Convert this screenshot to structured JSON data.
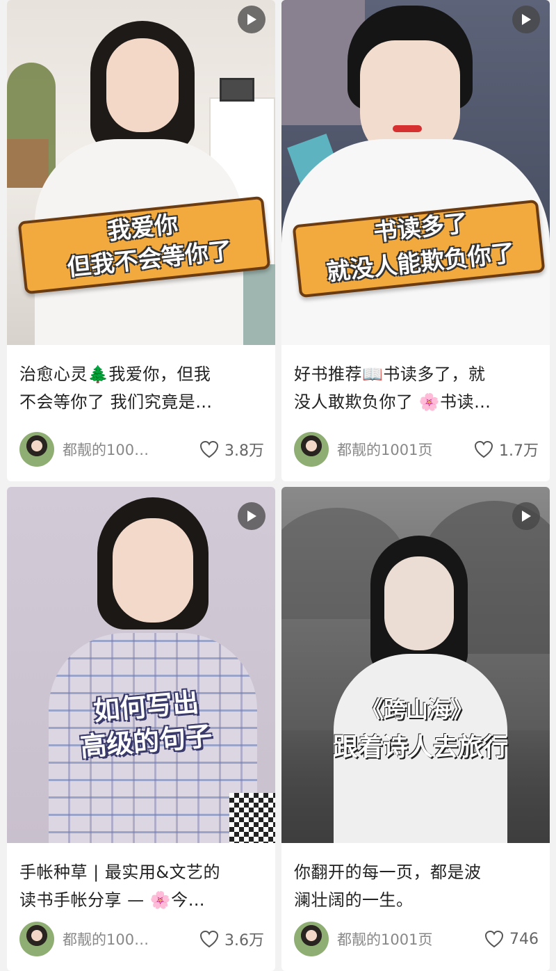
{
  "cards": [
    {
      "title_line1": "治愈心灵🌲我爱你，但我",
      "title_line2": "不会等你了 我们究竟是…",
      "overlay_line1": "我爱你",
      "overlay_line2": "但我不会等你了",
      "author": "都靓的100…",
      "likes": "3.8万"
    },
    {
      "title_line1": "好书推荐📖书读多了，就",
      "title_line2": "没人敢欺负你了 🌸书读…",
      "overlay_line1": "书读多了",
      "overlay_line2": "就没人能欺负你了",
      "author": "都靓的1001页",
      "likes": "1.7万"
    },
    {
      "title_line1": "手帐种草 | 最实用&文艺的",
      "title_line2": "读书手帐分享 — 🌸今…",
      "overlay_line1": "如何写出",
      "overlay_line2": "高级的句子",
      "author": "都靓的100…",
      "likes": "3.6万"
    },
    {
      "title_line1": "你翻开的每一页，都是波",
      "title_line2": "澜壮阔的一生。",
      "overlay_line1": "《跨山海》",
      "overlay_line2": "跟着诗人去旅行",
      "author": "都靓的1001页",
      "likes": "746"
    }
  ],
  "icons": {
    "play": "play-icon",
    "heart": "heart-outline-icon"
  },
  "colors": {
    "banner": "#f2a93e",
    "text_meta": "#888888"
  }
}
